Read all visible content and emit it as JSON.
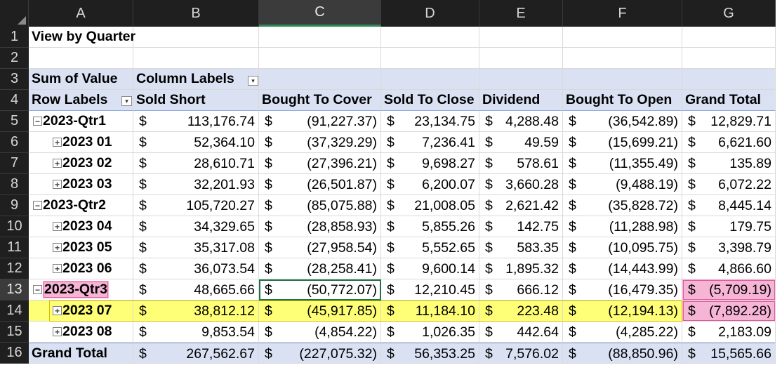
{
  "columns": [
    "A",
    "B",
    "C",
    "D",
    "E",
    "F",
    "G"
  ],
  "selected_column": "C",
  "selected_row": "13",
  "rows": [
    "1",
    "2",
    "3",
    "4",
    "5",
    "6",
    "7",
    "8",
    "9",
    "10",
    "11",
    "12",
    "13",
    "14",
    "15",
    "16"
  ],
  "cells": {
    "a1": "View by Quarter",
    "a3": "Sum of Value",
    "b3": "Column Labels",
    "a4": "Row Labels",
    "headers": [
      "Sold Short",
      "Bought To Cover",
      "Sold To Close",
      "Dividend",
      "Bought To Open",
      "Grand Total"
    ]
  },
  "currency_symbol": "$",
  "data_rows": [
    {
      "row": "5",
      "label": "2023-Qtr1",
      "level": "quarter",
      "expander": "minus",
      "values": [
        "113,176.74",
        "(91,227.37)",
        "23,134.75",
        "4,288.48",
        "(36,542.89)",
        "12,829.71"
      ]
    },
    {
      "row": "6",
      "label": "2023 01",
      "level": "month",
      "expander": "plus",
      "values": [
        "52,364.10",
        "(37,329.29)",
        "7,236.41",
        "49.59",
        "(15,699.21)",
        "6,621.60"
      ]
    },
    {
      "row": "7",
      "label": "2023 02",
      "level": "month",
      "expander": "plus",
      "values": [
        "28,610.71",
        "(27,396.21)",
        "9,698.27",
        "578.61",
        "(11,355.49)",
        "135.89"
      ]
    },
    {
      "row": "8",
      "label": "2023 03",
      "level": "month",
      "expander": "plus",
      "values": [
        "32,201.93",
        "(26,501.87)",
        "6,200.07",
        "3,660.28",
        "(9,488.19)",
        "6,072.22"
      ]
    },
    {
      "row": "9",
      "label": "2023-Qtr2",
      "level": "quarter",
      "expander": "minus",
      "values": [
        "105,720.27",
        "(85,075.88)",
        "21,008.05",
        "2,621.42",
        "(35,828.72)",
        "8,445.14"
      ]
    },
    {
      "row": "10",
      "label": "2023 04",
      "level": "month",
      "expander": "plus",
      "values": [
        "34,329.65",
        "(28,858.93)",
        "5,855.26",
        "142.75",
        "(11,288.98)",
        "179.75"
      ]
    },
    {
      "row": "11",
      "label": "2023 05",
      "level": "month",
      "expander": "plus",
      "values": [
        "35,317.08",
        "(27,958.54)",
        "5,552.65",
        "583.35",
        "(10,095.75)",
        "3,398.79"
      ]
    },
    {
      "row": "12",
      "label": "2023 06",
      "level": "month",
      "expander": "plus",
      "values": [
        "36,073.54",
        "(28,258.41)",
        "9,600.14",
        "1,895.32",
        "(14,443.99)",
        "4,866.60"
      ]
    },
    {
      "row": "13",
      "label": "2023-Qtr3",
      "level": "quarter",
      "expander": "minus",
      "values": [
        "48,665.66",
        "(50,772.07)",
        "12,210.45",
        "666.12",
        "(16,479.35)",
        "(5,709.19)"
      ]
    },
    {
      "row": "14",
      "label": "2023 07",
      "level": "month",
      "expander": "plus",
      "values": [
        "38,812.12",
        "(45,917.85)",
        "11,184.10",
        "223.48",
        "(12,194.13)",
        "(7,892.28)"
      ]
    },
    {
      "row": "15",
      "label": "2023 08",
      "level": "month",
      "expander": "plus",
      "values": [
        "9,853.54",
        "(4,854.22)",
        "1,026.35",
        "442.64",
        "(4,285.22)",
        "2,183.09"
      ]
    },
    {
      "row": "16",
      "label": "Grand Total",
      "level": "total",
      "expander": "",
      "values": [
        "267,562.67",
        "(227,075.32)",
        "56,353.25",
        "7,576.02",
        "(88,850.96)",
        "15,565.66"
      ]
    }
  ],
  "highlight_colors": {
    "header_blue": "#d9e1f2",
    "pink": "#f7b5d6",
    "yellow": "#ffff77",
    "active_cell_border": "#217346"
  },
  "icons": {
    "filter_dropdown": "filter-dropdown-icon",
    "expand": "expand-plus-icon",
    "collapse": "collapse-minus-icon"
  }
}
